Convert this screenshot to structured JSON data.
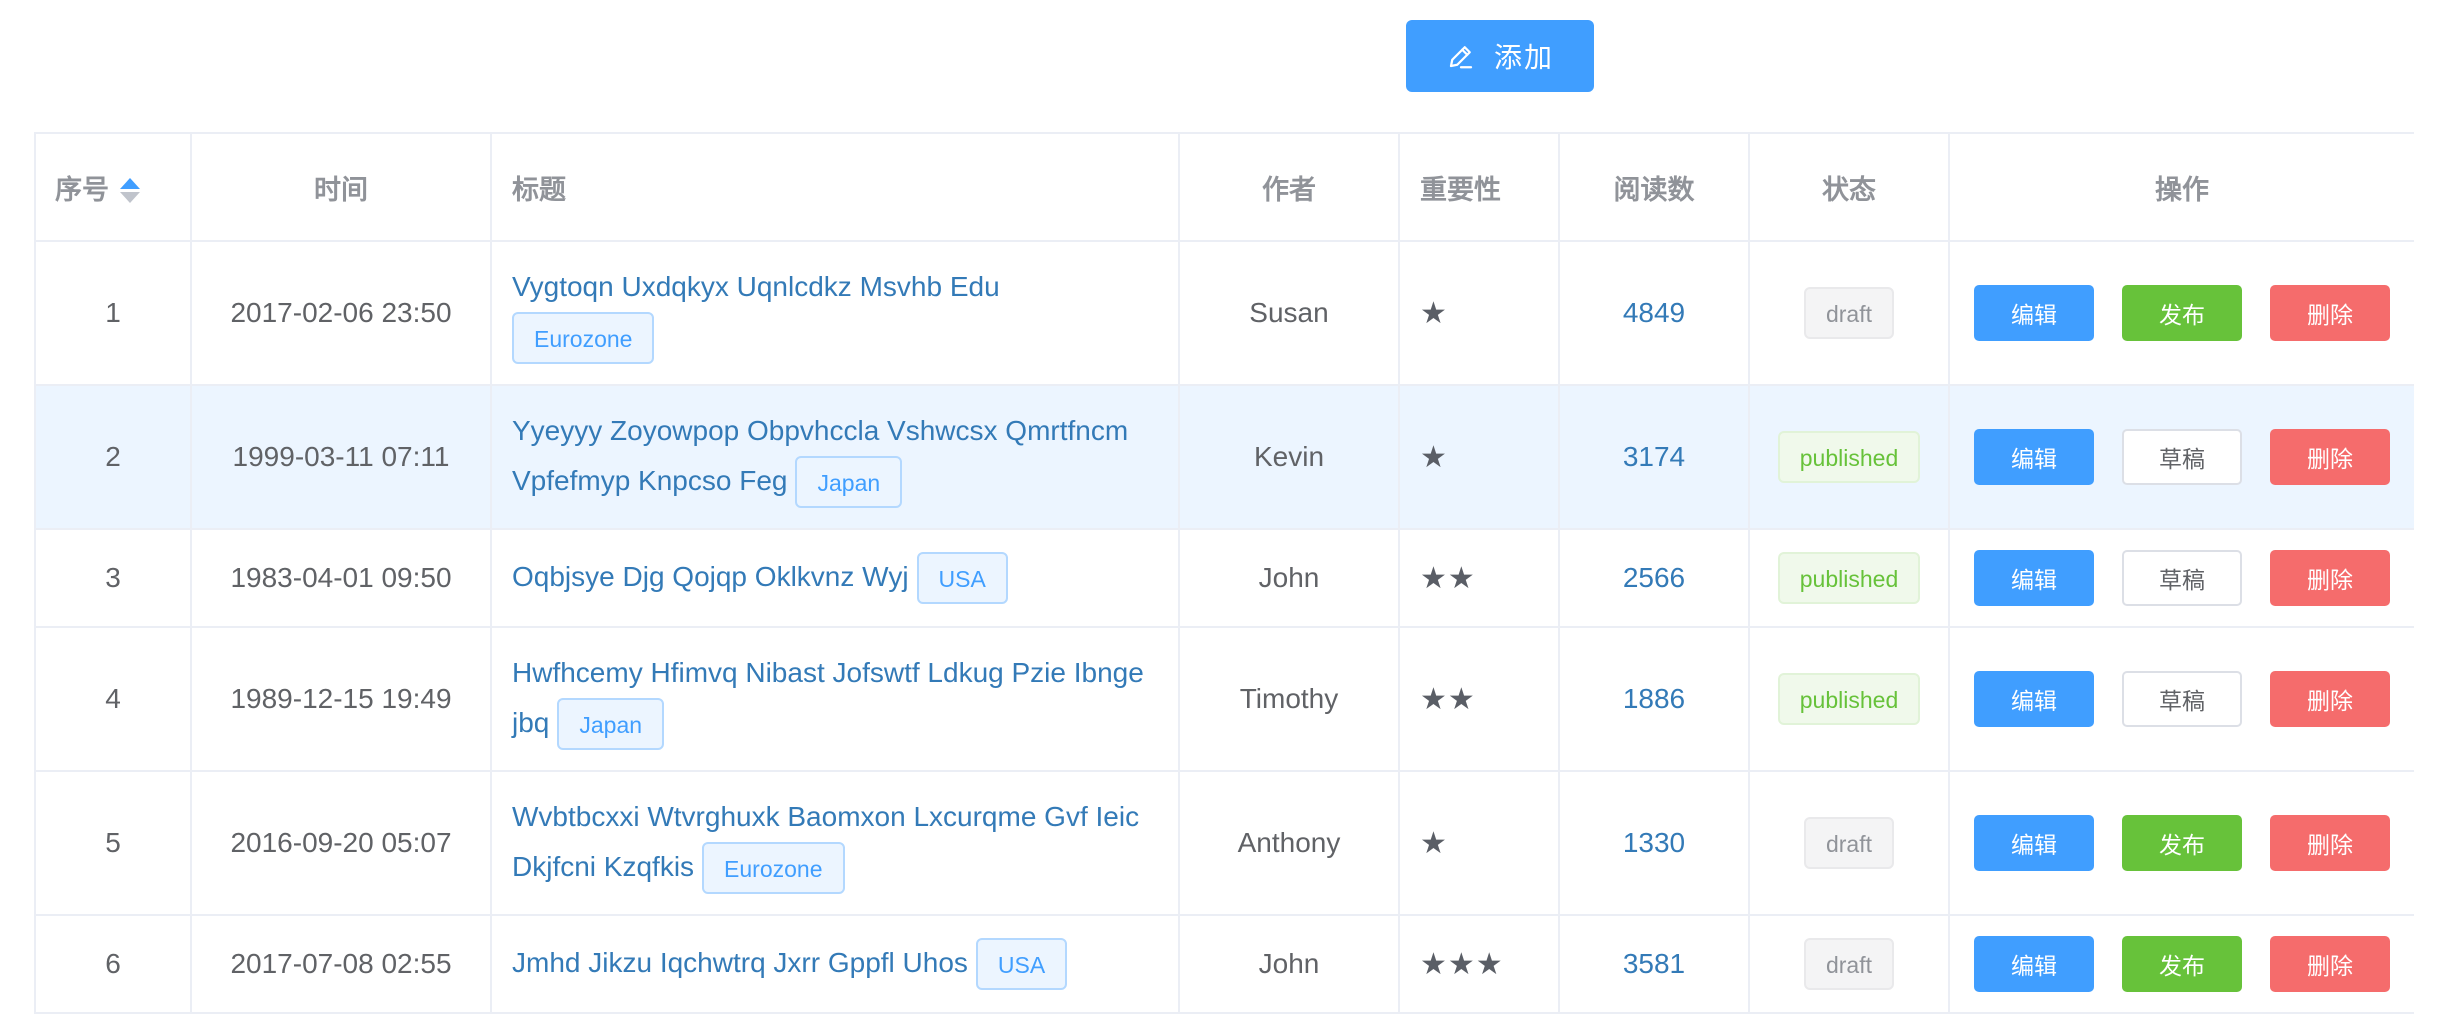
{
  "toolbar": {
    "add_label": "添加"
  },
  "table": {
    "columns": [
      "序号",
      "时间",
      "标题",
      "作者",
      "重要性",
      "阅读数",
      "状态",
      "操作"
    ],
    "rows": [
      {
        "id": "1",
        "time": "2017-02-06 23:50",
        "title": "Vygtoqn Uxdqkyx Uqnlcdkz Msvhb Edu",
        "region": "Eurozone",
        "author": "Susan",
        "importance": "★",
        "reads": "4849",
        "status": "draft",
        "actions": [
          "编辑",
          "发布",
          "删除"
        ]
      },
      {
        "id": "2",
        "time": "1999-03-11 07:11",
        "title": "Yyeyyy Zoyowpop Obpvhccla Vshwcsx Qmrtfncm Vpfefmyp Knpcso Feg",
        "region": "Japan",
        "author": "Kevin",
        "importance": "★",
        "reads": "3174",
        "status": "published",
        "actions": [
          "编辑",
          "草稿",
          "删除"
        ]
      },
      {
        "id": "3",
        "time": "1983-04-01 09:50",
        "title": "Oqbjsye Djg Qojqp Oklkvnz Wyj",
        "region": "USA",
        "author": "John",
        "importance": "★★",
        "reads": "2566",
        "status": "published",
        "actions": [
          "编辑",
          "草稿",
          "删除"
        ]
      },
      {
        "id": "4",
        "time": "1989-12-15 19:49",
        "title": "Hwfhcemy Hfimvq Nibast Jofswtf Ldkug Pzie Ibnge jbq",
        "region": "Japan",
        "author": "Timothy",
        "importance": "★★",
        "reads": "1886",
        "status": "published",
        "actions": [
          "编辑",
          "草稿",
          "删除"
        ]
      },
      {
        "id": "5",
        "time": "2016-09-20 05:07",
        "title": "Wvbtbcxxi Wtvrghuxk Baomxon Lxcurqme Gvf Ieic Dkjfcni Kzqfkis",
        "region": "Eurozone",
        "author": "Anthony",
        "importance": "★",
        "reads": "1330",
        "status": "draft",
        "actions": [
          "编辑",
          "发布",
          "删除"
        ]
      },
      {
        "id": "6",
        "time": "2017-07-08 02:55",
        "title": "Jmhd Jikzu Iqchwtrq Jxrr Gppfl Uhos",
        "region": "USA",
        "author": "John",
        "importance": "★★★",
        "reads": "3581",
        "status": "draft",
        "actions": [
          "编辑",
          "发布",
          "删除"
        ]
      }
    ]
  },
  "colors": {
    "primary": "#409eff",
    "success": "#67c23a",
    "danger": "#f56c6c",
    "link": "#337ab7",
    "row_highlight": "#ecf5ff"
  }
}
